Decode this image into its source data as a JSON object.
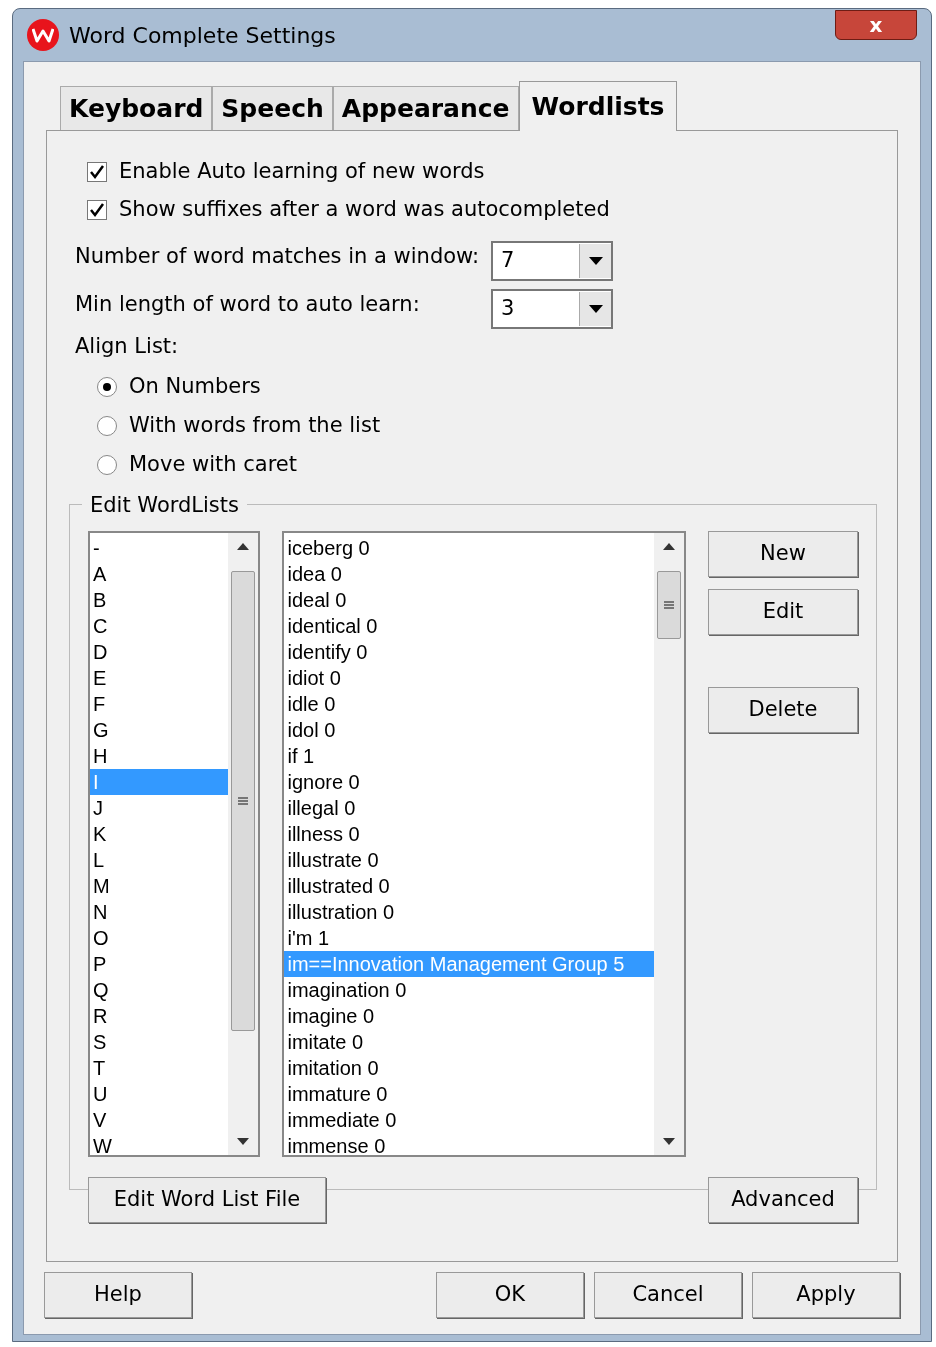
{
  "window": {
    "title": "Word Complete Settings",
    "close_label": "x"
  },
  "tabs": [
    {
      "label": "Keyboard",
      "selected": false
    },
    {
      "label": "Speech",
      "selected": false
    },
    {
      "label": "Appearance",
      "selected": false
    },
    {
      "label": "Wordlists",
      "selected": true
    }
  ],
  "checkboxes": [
    {
      "label": "Enable Auto learning of new words",
      "checked": true
    },
    {
      "label": "Show suffixes after a word was autocompleted",
      "checked": true
    }
  ],
  "dropdowns": [
    {
      "label": "Number of word matches in a window:",
      "value": "7"
    },
    {
      "label": "Min length of word to auto learn:",
      "value": "3"
    }
  ],
  "align_list": {
    "label": "Align List:",
    "options": [
      {
        "label": "On Numbers",
        "selected": true
      },
      {
        "label": "With words from the list",
        "selected": false
      },
      {
        "label": "Move with caret",
        "selected": false
      }
    ]
  },
  "edit_wordlists": {
    "title": "Edit WordLists",
    "letters": [
      {
        "label": "-",
        "selected": false
      },
      {
        "label": "A",
        "selected": false
      },
      {
        "label": "B",
        "selected": false
      },
      {
        "label": "C",
        "selected": false
      },
      {
        "label": "D",
        "selected": false
      },
      {
        "label": "E",
        "selected": false
      },
      {
        "label": "F",
        "selected": false
      },
      {
        "label": "G",
        "selected": false
      },
      {
        "label": "H",
        "selected": false
      },
      {
        "label": "I",
        "selected": true
      },
      {
        "label": "J",
        "selected": false
      },
      {
        "label": "K",
        "selected": false
      },
      {
        "label": "L",
        "selected": false
      },
      {
        "label": "M",
        "selected": false
      },
      {
        "label": "N",
        "selected": false
      },
      {
        "label": "O",
        "selected": false
      },
      {
        "label": "P",
        "selected": false
      },
      {
        "label": "Q",
        "selected": false
      },
      {
        "label": "R",
        "selected": false
      },
      {
        "label": "S",
        "selected": false
      },
      {
        "label": "T",
        "selected": false
      },
      {
        "label": "U",
        "selected": false
      },
      {
        "label": "V",
        "selected": false
      },
      {
        "label": "W",
        "selected": false
      }
    ],
    "words": [
      {
        "label": "iceberg 0",
        "selected": false
      },
      {
        "label": "idea 0",
        "selected": false
      },
      {
        "label": "ideal 0",
        "selected": false
      },
      {
        "label": "identical 0",
        "selected": false
      },
      {
        "label": "identify 0",
        "selected": false
      },
      {
        "label": "idiot 0",
        "selected": false
      },
      {
        "label": "idle 0",
        "selected": false
      },
      {
        "label": "idol 0",
        "selected": false
      },
      {
        "label": "if 1",
        "selected": false
      },
      {
        "label": "ignore 0",
        "selected": false
      },
      {
        "label": "illegal 0",
        "selected": false
      },
      {
        "label": "illness 0",
        "selected": false
      },
      {
        "label": "illustrate 0",
        "selected": false
      },
      {
        "label": "illustrated 0",
        "selected": false
      },
      {
        "label": "illustration 0",
        "selected": false
      },
      {
        "label": "i'm 1",
        "selected": false
      },
      {
        "label": "im==Innovation Management Group 5",
        "selected": true
      },
      {
        "label": "imagination 0",
        "selected": false
      },
      {
        "label": "imagine 0",
        "selected": false
      },
      {
        "label": "imitate 0",
        "selected": false
      },
      {
        "label": "imitation 0",
        "selected": false
      },
      {
        "label": "immature 0",
        "selected": false
      },
      {
        "label": "immediate 0",
        "selected": false
      },
      {
        "label": "immense 0",
        "selected": false
      }
    ],
    "side_buttons": [
      "New",
      "Edit",
      "Delete"
    ],
    "bottom_buttons": [
      "Edit Word List File",
      "Advanced"
    ]
  },
  "footer_buttons": [
    "Help",
    "OK",
    "Cancel",
    "Apply"
  ]
}
